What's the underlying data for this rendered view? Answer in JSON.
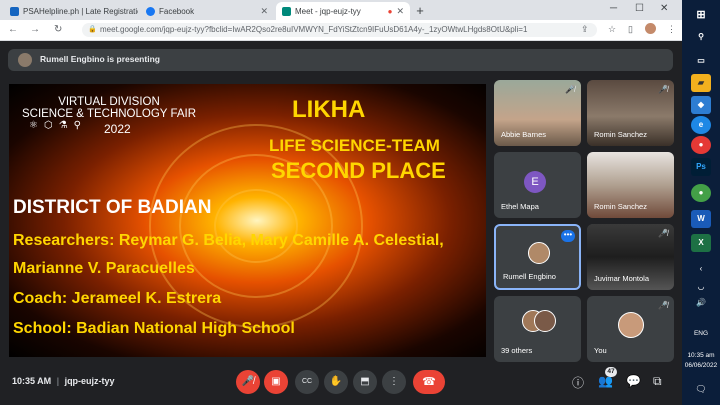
{
  "tabs": [
    {
      "title": "PSAHelpline.ph | Late Registratio",
      "color": "#1565c0"
    },
    {
      "title": "Facebook",
      "color": "#1877f2"
    },
    {
      "title": "Meet - jqp-eujz-tyy",
      "color": "#00897b"
    }
  ],
  "url": "meet.google.com/jqp-eujz-tyy?fbclid=IwAR2Qso2re8uIVMWYN_FdYiStZtcn9IFuUsD61A4y-_1zyOWtwLHgds8OtU&pli=1",
  "presenting": "Rumell Engbino is presenting",
  "slide": {
    "event_title": "VIRTUAL DIVISION\nSCIENCE & TECHNOLOGY FAIR",
    "year": "2022",
    "title": "LIKHA",
    "category": "LIFE SCIENCE-TEAM",
    "place": "SECOND PLACE",
    "district": "DISTRICT OF BADIAN",
    "researchers_1": "Researchers: Reymar G. Belia, Mary Camille A. Celestial,",
    "researchers_2": "Marianne V. Paracuelles",
    "coach": "Coach: Jerameel K. Estrera",
    "school": "School: Badian National High School"
  },
  "participants": [
    {
      "name": "Abbie Barnes"
    },
    {
      "name": "Romin Sanchez"
    },
    {
      "name": "Ethel Mapa",
      "initial": "E"
    },
    {
      "name": "Romin Sanchez"
    },
    {
      "name": "Rumell Engbino"
    },
    {
      "name": "Juvimar Montola"
    },
    {
      "name": "39 others"
    },
    {
      "name": "You"
    }
  ],
  "meeting": {
    "time": "10:35 AM",
    "separator": "|",
    "code": "jqp-eujz-tyy",
    "people_count": "47"
  },
  "taskbar": {
    "lang": "ENG",
    "time": "10:35 am",
    "date": "06/06/2022"
  }
}
